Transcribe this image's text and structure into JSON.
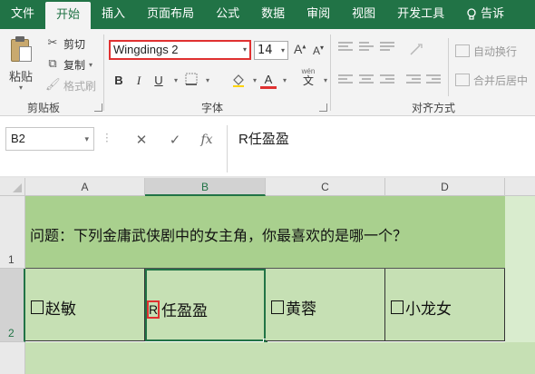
{
  "tabs": [
    {
      "label": "文件",
      "active": false
    },
    {
      "label": "开始",
      "active": true
    },
    {
      "label": "插入",
      "active": false
    },
    {
      "label": "页面布局",
      "active": false
    },
    {
      "label": "公式",
      "active": false
    },
    {
      "label": "数据",
      "active": false
    },
    {
      "label": "审阅",
      "active": false
    },
    {
      "label": "视图",
      "active": false
    },
    {
      "label": "开发工具",
      "active": false
    }
  ],
  "tell_me": "告诉",
  "clipboard": {
    "paste_label": "粘贴",
    "cut_label": "剪切",
    "copy_label": "复制",
    "format_painter_label": "格式刷",
    "group_label": "剪贴板"
  },
  "font": {
    "name": "Wingdings 2",
    "size": "14",
    "grow_label": "A",
    "shrink_label": "A",
    "bold_label": "B",
    "italic_label": "I",
    "underline_label": "U",
    "wen_label": "wén",
    "wen_char": "文",
    "font_color_label": "A",
    "group_label": "字体",
    "accent_color": "#e03131"
  },
  "alignment": {
    "wrap_label": "自动换行",
    "merge_label": "合并后居中",
    "group_label": "对齐方式"
  },
  "formula_bar": {
    "name_box": "B2",
    "cancel_glyph": "✕",
    "enter_glyph": "✓",
    "fx_glyph": "fx",
    "content": "R任盈盈"
  },
  "grid": {
    "columns": [
      "A",
      "B",
      "C",
      "D"
    ],
    "rows": [
      "1",
      "2"
    ],
    "selected_cell": "B2",
    "row1_text": "问题：下列金庸武侠剧中的女主角，你最喜欢的是哪一个？",
    "row2": {
      "a": "赵敏",
      "b_mark": "R",
      "b": "任盈盈",
      "c": "黄蓉",
      "d": "小龙女"
    },
    "header_fill": "#a9d08e",
    "cell_fill": "#c6e0b4"
  }
}
